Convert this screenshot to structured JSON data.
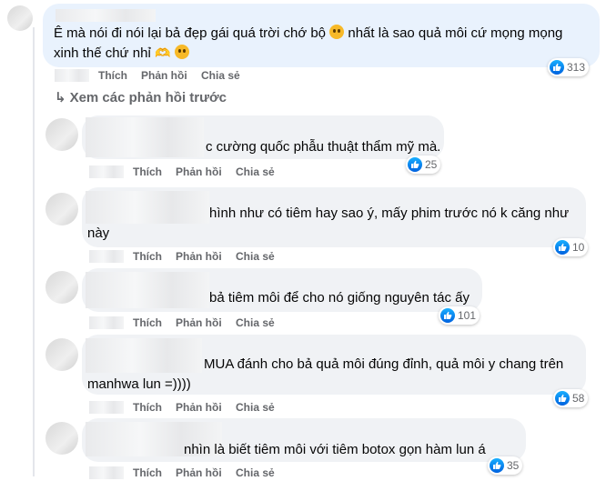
{
  "actions": {
    "like": "Thích",
    "reply": "Phản hồi",
    "share": "Chia sẻ"
  },
  "view_previous": "Xem các phản hồi trước",
  "top_comment": {
    "line1a": "Ê mà nói đi nói lại bả đẹp gái quá trời chớ bộ",
    "line1b": "nhất là sao quả môi cứ mọng mọng",
    "line2": "xinh thế chứ nhỉ",
    "reactions": "313"
  },
  "replies": [
    {
      "line1": "c cường quốc phẫu thuật thẩm mỹ mà.",
      "line2": "",
      "reactions": "25"
    },
    {
      "line1": "hình như có tiêm hay sao ý, mấy phim trước nó k căng như",
      "line2": "này",
      "reactions": "10"
    },
    {
      "line1": "bả tiêm môi để cho nó giống nguyên tác ấy",
      "line2": "",
      "reactions": "101"
    },
    {
      "line1": "MUA đánh cho bả quả môi đúng đỉnh, quả môi y chang trên",
      "line2": "manhwa lun =))))",
      "reactions": "58"
    },
    {
      "line1": "nhìn là biết tiêm môi với tiêm botox gọn hàm lun á",
      "line2": "",
      "reactions": "35"
    }
  ],
  "colors": {
    "like_blue": "#0866ff",
    "bubble": "#f0f2f5",
    "meta": "#65676b"
  }
}
